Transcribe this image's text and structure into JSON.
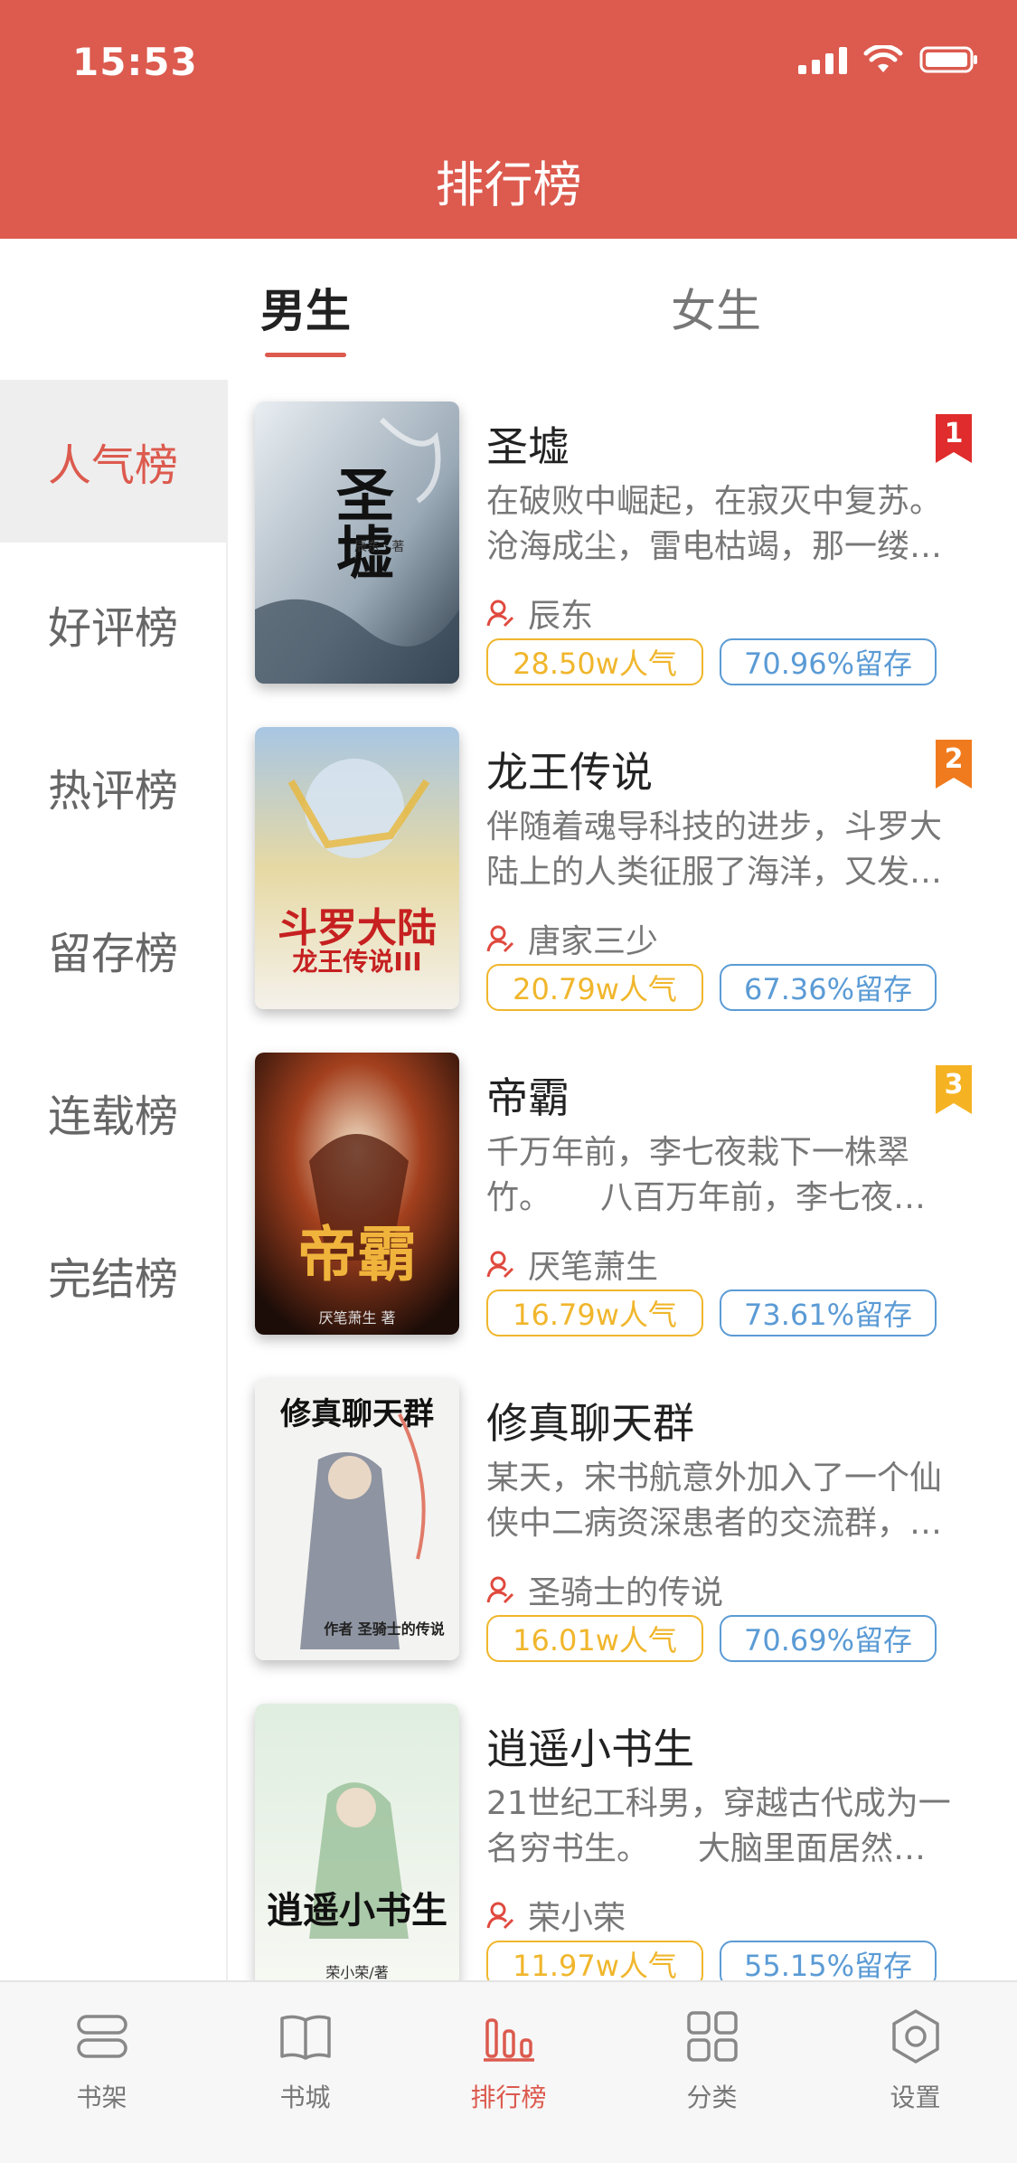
{
  "status": {
    "time": "15:53"
  },
  "header": {
    "title": "排行榜"
  },
  "gender_tabs": [
    {
      "label": "男生",
      "active": true
    },
    {
      "label": "女生",
      "active": false
    }
  ],
  "sidebar": {
    "items": [
      {
        "label": "人气榜",
        "active": true
      },
      {
        "label": "好评榜",
        "active": false
      },
      {
        "label": "热评榜",
        "active": false
      },
      {
        "label": "留存榜",
        "active": false
      },
      {
        "label": "连载榜",
        "active": false
      },
      {
        "label": "完结榜",
        "active": false
      }
    ]
  },
  "books": [
    {
      "rank": "1",
      "rank_color": "#e02c2c",
      "title": "圣墟",
      "desc": "在破败中崛起，在寂灭中复苏。沧海成尘，雷电枯竭，那一缕…",
      "author": "辰东",
      "popularity": "28.50w人气",
      "retention": "70.96%留存",
      "cover_text": "圣墟",
      "cover_sub": "辰东 · 著"
    },
    {
      "rank": "2",
      "rank_color": "#f07b1e",
      "title": "龙王传说",
      "desc": "伴随着魂导科技的进步，斗罗大陆上的人类征服了海洋，又发…",
      "author": "唐家三少",
      "popularity": "20.79w人气",
      "retention": "67.36%留存",
      "cover_text": "斗罗大陆",
      "cover_sub": "龙王传说III"
    },
    {
      "rank": "3",
      "rank_color": "#f5b324",
      "title": "帝霸",
      "desc": "千万年前，李七夜栽下一株翠竹。　　八百万年前，李七夜…",
      "author": "厌笔萧生",
      "popularity": "16.79w人气",
      "retention": "73.61%留存",
      "cover_text": "帝霸",
      "cover_sub": "厌笔萧生 著"
    },
    {
      "rank": "",
      "rank_color": "",
      "title": "修真聊天群",
      "desc": "某天，宋书航意外加入了一个仙侠中二病资深患者的交流群，…",
      "author": "圣骑士的传说",
      "popularity": "16.01w人气",
      "retention": "70.69%留存",
      "cover_text": "修真聊天群",
      "cover_sub": "作者 圣骑士的传说"
    },
    {
      "rank": "",
      "rank_color": "",
      "title": "逍遥小书生",
      "desc": "21世纪工科男，穿越古代成为一名穷书生。　　大脑里面居然…",
      "author": "荣小荣",
      "popularity": "11.97w人气",
      "retention": "55.15%留存",
      "cover_text": "逍遥小书生",
      "cover_sub": "荣小荣/著"
    }
  ],
  "tabbar": [
    {
      "label": "书架",
      "icon": "bookshelf-icon",
      "active": false
    },
    {
      "label": "书城",
      "icon": "book-open-icon",
      "active": false
    },
    {
      "label": "排行榜",
      "icon": "ranking-chart-icon",
      "active": true
    },
    {
      "label": "分类",
      "icon": "grid-icon",
      "active": false
    },
    {
      "label": "设置",
      "icon": "settings-hexagon-icon",
      "active": false
    }
  ],
  "colors": {
    "brand": "#dc5a4e",
    "popularity": "#f0b62c",
    "retention": "#5b9bd5"
  }
}
